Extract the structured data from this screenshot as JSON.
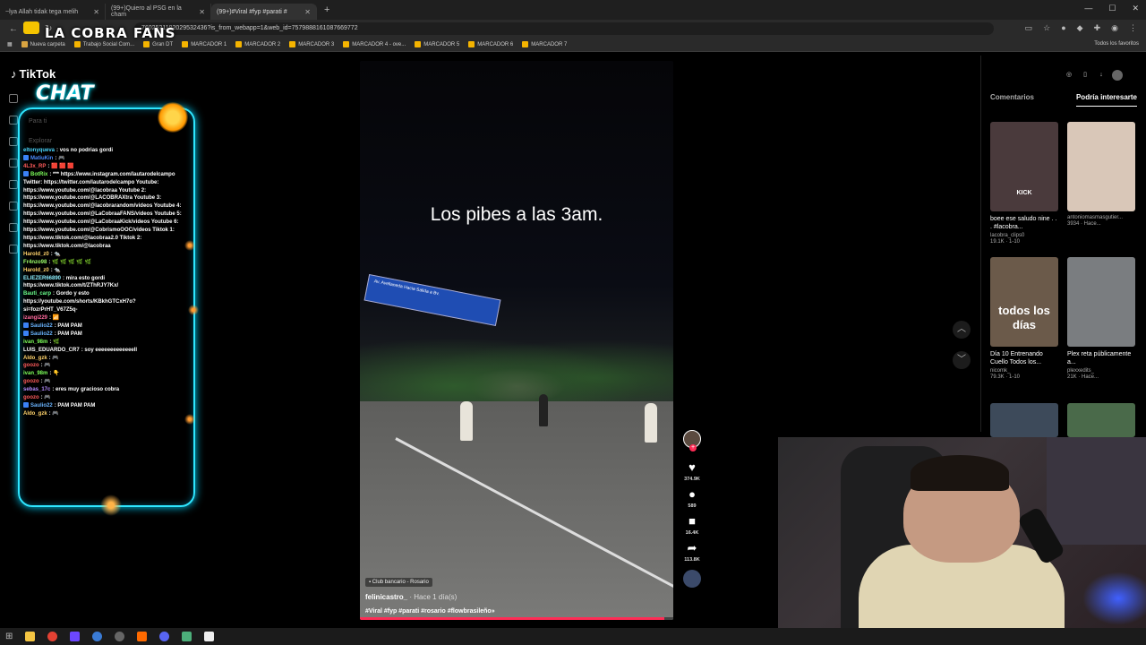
{
  "browser": {
    "tabs": [
      {
        "title": "~lya Allah tidak tega melih",
        "active": false
      },
      {
        "title": "(99+)Quiero al PSG en la cham",
        "active": false
      },
      {
        "title": "(99+)#Viral #fyp #parati #",
        "active": true
      }
    ],
    "url": "7602521182029532436?is_from_webapp=1&web_id=7579888161087669772",
    "bookmarks": [
      "Nueva carpeta",
      "Trabajo Social Com...",
      "Gran DT",
      "MARCADOR 1",
      "MARCADOR 2",
      "MARCADOR 3",
      "MARCADOR 4 - ove...",
      "MARCADOR 5",
      "MARCADOR 6",
      "MARCADOR 7"
    ],
    "bookmarks_right": "Todos los favoritos"
  },
  "overlay": {
    "banner": "LA COBRA FANS",
    "chat_title": "CHAT"
  },
  "tiktok": {
    "logo": "TikTok",
    "faded_items": [
      "Para ti",
      "Explorar"
    ]
  },
  "chat": [
    {
      "user": "eltonyqueva",
      "text": "vos no podrias gordi",
      "color": "#4ad7ff"
    },
    {
      "user": "MatiuKin",
      "text": "🎮",
      "color": "#4a8bff",
      "badge": true
    },
    {
      "user": "4L3x_RP",
      "text": "🟥 🟥 🟥",
      "color": "#ff5b5b"
    },
    {
      "user": "BotRix",
      "text": "*** https://www.instagram.com/lautarodelcampo Twitter: https://twitter.com/lautarodelcampo Youtube: https://www.youtube.com/@lacobraa Youtube 2: https://www.youtube.com/@LACOBRAXtra Youtube 3: https://www.youtube.com/@lacobrarandom/videos Youtube 4: https://www.youtube.com/@LaCobraaFANS/videos Youtube 5: https://www.youtube.com/@LaCobraaKick/videos Youtube 6: https://www.youtube.com/@CobrismoOOC/videos Tiktok 1: https://www.tiktok.com/@lacobraa2.0 Tiktok 2: https://www.tiktok.com/@lacobraa",
      "color": "#7dff5a",
      "badge": true
    },
    {
      "user": "Harold_z0",
      "text": "🐀",
      "color": "#ffd36b"
    },
    {
      "user": "Fr4nzo98",
      "text": "🌿 🌿 🌿 🌿 🌿",
      "color": "#9dff6a"
    },
    {
      "user": "Harold_z0",
      "text": "🐀",
      "color": "#ffd36b"
    },
    {
      "user": "ELIEZER66890",
      "text": "mira esto gordi https://www.tiktok.com/t/ZThRJY7Kx/",
      "color": "#8cf0ff"
    },
    {
      "user": "Bauti_carp",
      "text": "Gordo y esto https://youtube.com/shorts/KBkhGTCxH7o?si=fozrPrHT_V67Z5q-",
      "color": "#6aff8c"
    },
    {
      "user": "izangi229",
      "text": "📶",
      "color": "#ff6a9d"
    },
    {
      "user": "Saulio22",
      "text": "PAM PAM",
      "color": "#6ab4ff",
      "badge": true
    },
    {
      "user": "Saulio22",
      "text": "PAM PAM",
      "color": "#6ab4ff",
      "badge": true
    },
    {
      "user": "ivan_98m",
      "text": "🌿",
      "color": "#7dff5a"
    },
    {
      "user": "LUIS_EDUARDO_CR7",
      "text": "soy eeeeeeeeeeeeell",
      "color": "#ffffff"
    },
    {
      "user": "Aldo_gzk",
      "text": "🎮",
      "color": "#ffd36b"
    },
    {
      "user": "goozo",
      "text": "🎮",
      "color": "#ff5b5b"
    },
    {
      "user": "ivan_98m",
      "text": "👇",
      "color": "#7dff5a"
    },
    {
      "user": "goozo",
      "text": "🎮",
      "color": "#ff5b5b"
    },
    {
      "user": "sebas_17c",
      "text": "eres muy gracioso cobra",
      "color": "#b48cff"
    },
    {
      "user": "goozo",
      "text": "🎮",
      "color": "#ff5b5b"
    },
    {
      "user": "Saulio22",
      "text": "PAM PAM PAM",
      "color": "#6ab4ff",
      "badge": true
    },
    {
      "user": "Aldo_gzk",
      "text": "🎮",
      "color": "#ffd36b"
    }
  ],
  "video": {
    "caption": "Los pibes a las 3am.",
    "sign_text": "Av. Avellaneda  Hacia Salida a Bv.",
    "location": "Club bancario - Rosario",
    "author": "felinicastro_",
    "time": "· Hace 1 día(s)",
    "tags": "#Viral #fyp #parati #rosario #flowbrasileño»",
    "progress": 0.97
  },
  "actions": {
    "likes": "374.9K",
    "comments": "589",
    "saves": "16.4K",
    "shares": "113.8K"
  },
  "right_panel": {
    "tabs": [
      "Comentarios",
      "Podría interesarte"
    ],
    "cards": [
      {
        "title": "boee ese saludo nine . . . #lacobra...",
        "author": "lacobra_clips0",
        "stats": "19.1K · 1-10",
        "bg": "#4a3a3c",
        "overlay": "KICK"
      },
      {
        "title": "",
        "author": "antoniomasmasgutier...",
        "stats": "3934 · Hace...",
        "bg": "#d9c7b8",
        "overlay": ""
      },
      {
        "title": "Día 10 Entrenando Cuello Todos los...",
        "author": "nicomk_",
        "stats": "79.3K · 1-10",
        "bg": "#6b5a4a",
        "overlay": "todos los días"
      },
      {
        "title": "Plex reta públicamente a...",
        "author": "plexxedits_",
        "stats": "21K · Hace...",
        "bg": "#7a7d80",
        "overlay": ""
      }
    ]
  }
}
